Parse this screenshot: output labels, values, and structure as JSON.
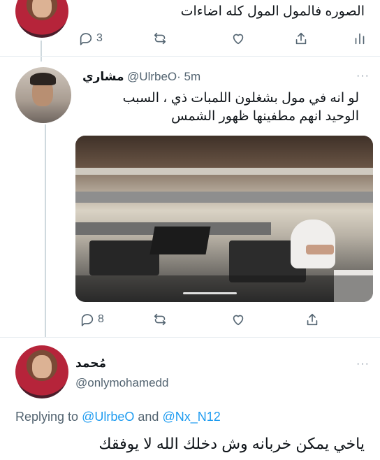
{
  "top_reply": {
    "text": "الصوره فالمول المول كله اضاءات",
    "reply_count": "3"
  },
  "tweet": {
    "display_name": "مشاري",
    "handle": "@UlrbeO",
    "time": "· 5m",
    "text_line1": "لو انه في مول بشغلون اللمبات ذي ، السبب",
    "text_line2": "الوحيد انهم مطفينها ظهور الشمس",
    "reply_count": "8",
    "media_progress": 0.7
  },
  "reply": {
    "display_name": "مُحمد",
    "handle": "@onlymohamedd",
    "replying_prefix": "Replying to",
    "replying_to_1": "@UlrbeO",
    "replying_and": "and",
    "replying_to_2": "@Nx_N12",
    "text": "ياخي يمكن خربانه وش دخلك الله لا يوفقك"
  },
  "more_label": "···",
  "icons": [
    "reply-icon",
    "retweet-icon",
    "like-icon",
    "share-icon",
    "analytics-icon"
  ],
  "colors": {
    "link": "#1d9bf0",
    "muted": "#536471",
    "divider": "#e6ecf0"
  }
}
